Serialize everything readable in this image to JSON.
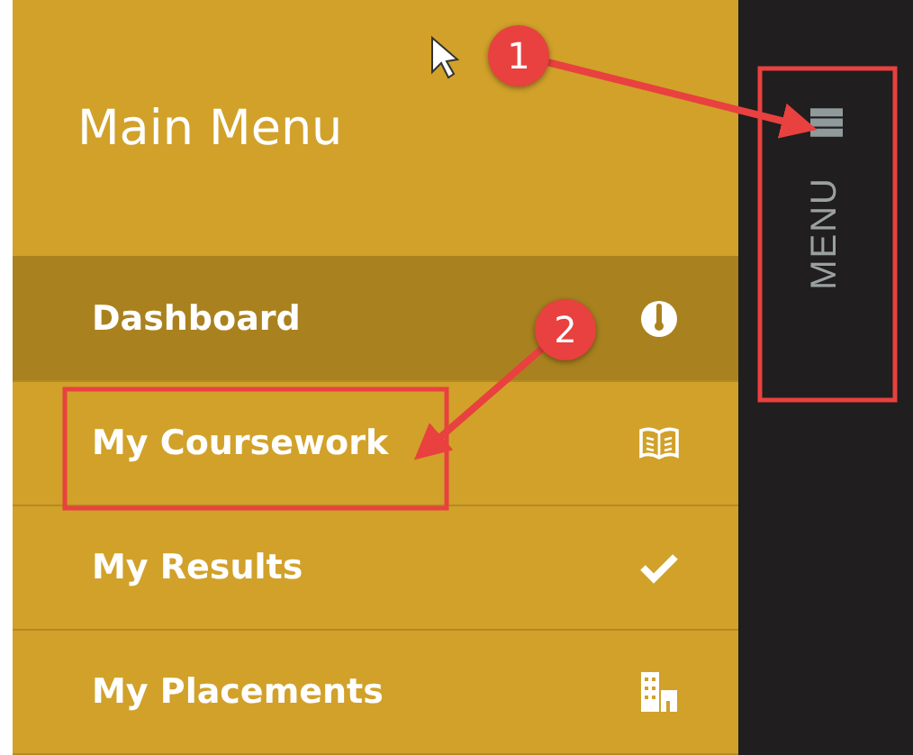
{
  "sidebar": {
    "title": "Main Menu",
    "items": [
      {
        "label": "Dashboard",
        "selected": true
      },
      {
        "label": "My Coursework",
        "selected": false
      },
      {
        "label": "My Results",
        "selected": false
      },
      {
        "label": "My Placements",
        "selected": false
      }
    ]
  },
  "menu_toggle": {
    "label": "MENU"
  },
  "annotations": [
    {
      "label": "1"
    },
    {
      "label": "2"
    }
  ]
}
